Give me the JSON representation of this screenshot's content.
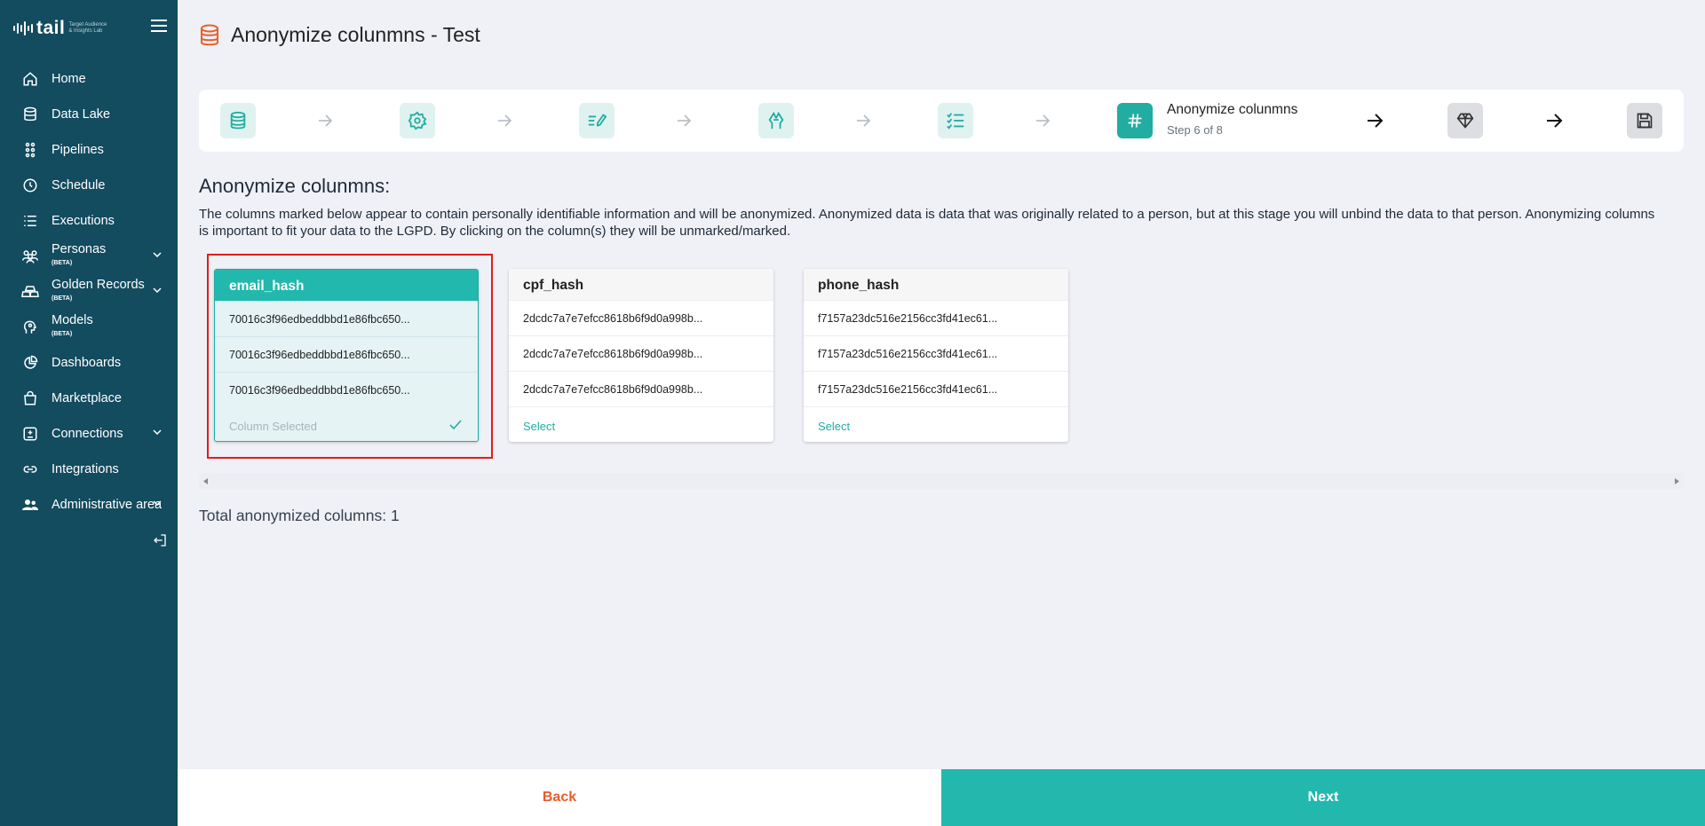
{
  "brand": {
    "name": "tail",
    "subtitle": "Target Audience & Insights Lab"
  },
  "nav": [
    {
      "label": "Home",
      "icon": "home-icon"
    },
    {
      "label": "Data Lake",
      "icon": "database-icon"
    },
    {
      "label": "Pipelines",
      "icon": "pipeline-icon"
    },
    {
      "label": "Schedule",
      "icon": "clock-icon"
    },
    {
      "label": "Executions",
      "icon": "list-icon"
    },
    {
      "label": "Personas",
      "badge": "(BETA)",
      "icon": "people-icon",
      "expandable": true
    },
    {
      "label": "Golden Records",
      "badge": "(BETA)",
      "icon": "gold-bars-icon",
      "expandable": true
    },
    {
      "label": "Models",
      "badge": "(BETA)",
      "icon": "head-gear-icon"
    },
    {
      "label": "Dashboards",
      "icon": "pie-chart-icon"
    },
    {
      "label": "Marketplace",
      "icon": "shopping-bag-icon"
    },
    {
      "label": "Connections",
      "icon": "plug-icon",
      "expandable": true
    },
    {
      "label": "Integrations",
      "icon": "link-icon"
    },
    {
      "label": "Administrative area",
      "icon": "users-admin-icon",
      "expandable": true
    }
  ],
  "page": {
    "title": "Anonymize colunmns - Test"
  },
  "stepper": {
    "current_title": "Anonymize colunmns",
    "current_sub": "Step 6 of 8",
    "steps": [
      "database-icon",
      "gear-icon",
      "edit-list-icon",
      "hands-icon",
      "checklist-icon",
      "hash-icon",
      "diamond-icon",
      "save-icon"
    ]
  },
  "section": {
    "title": "Anonymize colunmns:",
    "description": "The columns marked below appear to contain personally identifiable information and will be anonymized. Anonymized data is data that was originally related to a person, but at this stage you will unbind the data to that person. Anonymizing columns is important to fit your data to the LGPD. By clicking on the column(s) they will be unmarked/marked."
  },
  "columns": [
    {
      "name": "email_hash",
      "selected": true,
      "rows": [
        "70016c3f96edbeddbbd1e86fbc650...",
        "70016c3f96edbeddbbd1e86fbc650...",
        "70016c3f96edbeddbbd1e86fbc650..."
      ],
      "footer": "Column Selected"
    },
    {
      "name": "cpf_hash",
      "selected": false,
      "rows": [
        "2dcdc7a7e7efcc8618b6f9d0a998b...",
        "2dcdc7a7e7efcc8618b6f9d0a998b...",
        "2dcdc7a7e7efcc8618b6f9d0a998b..."
      ],
      "footer": "Select"
    },
    {
      "name": "phone_hash",
      "selected": false,
      "rows": [
        "f7157a23dc516e2156cc3fd41ec61...",
        "f7157a23dc516e2156cc3fd41ec61...",
        "f7157a23dc516e2156cc3fd41ec61..."
      ],
      "footer": "Select"
    }
  ],
  "total_text": "Total anonymized columns: 1",
  "footer": {
    "back": "Back",
    "next": "Next"
  },
  "colors": {
    "sidebar": "#134b5f",
    "accent": "#22b8ae",
    "back": "#e85c2c",
    "title_icon": "#e8602c"
  }
}
